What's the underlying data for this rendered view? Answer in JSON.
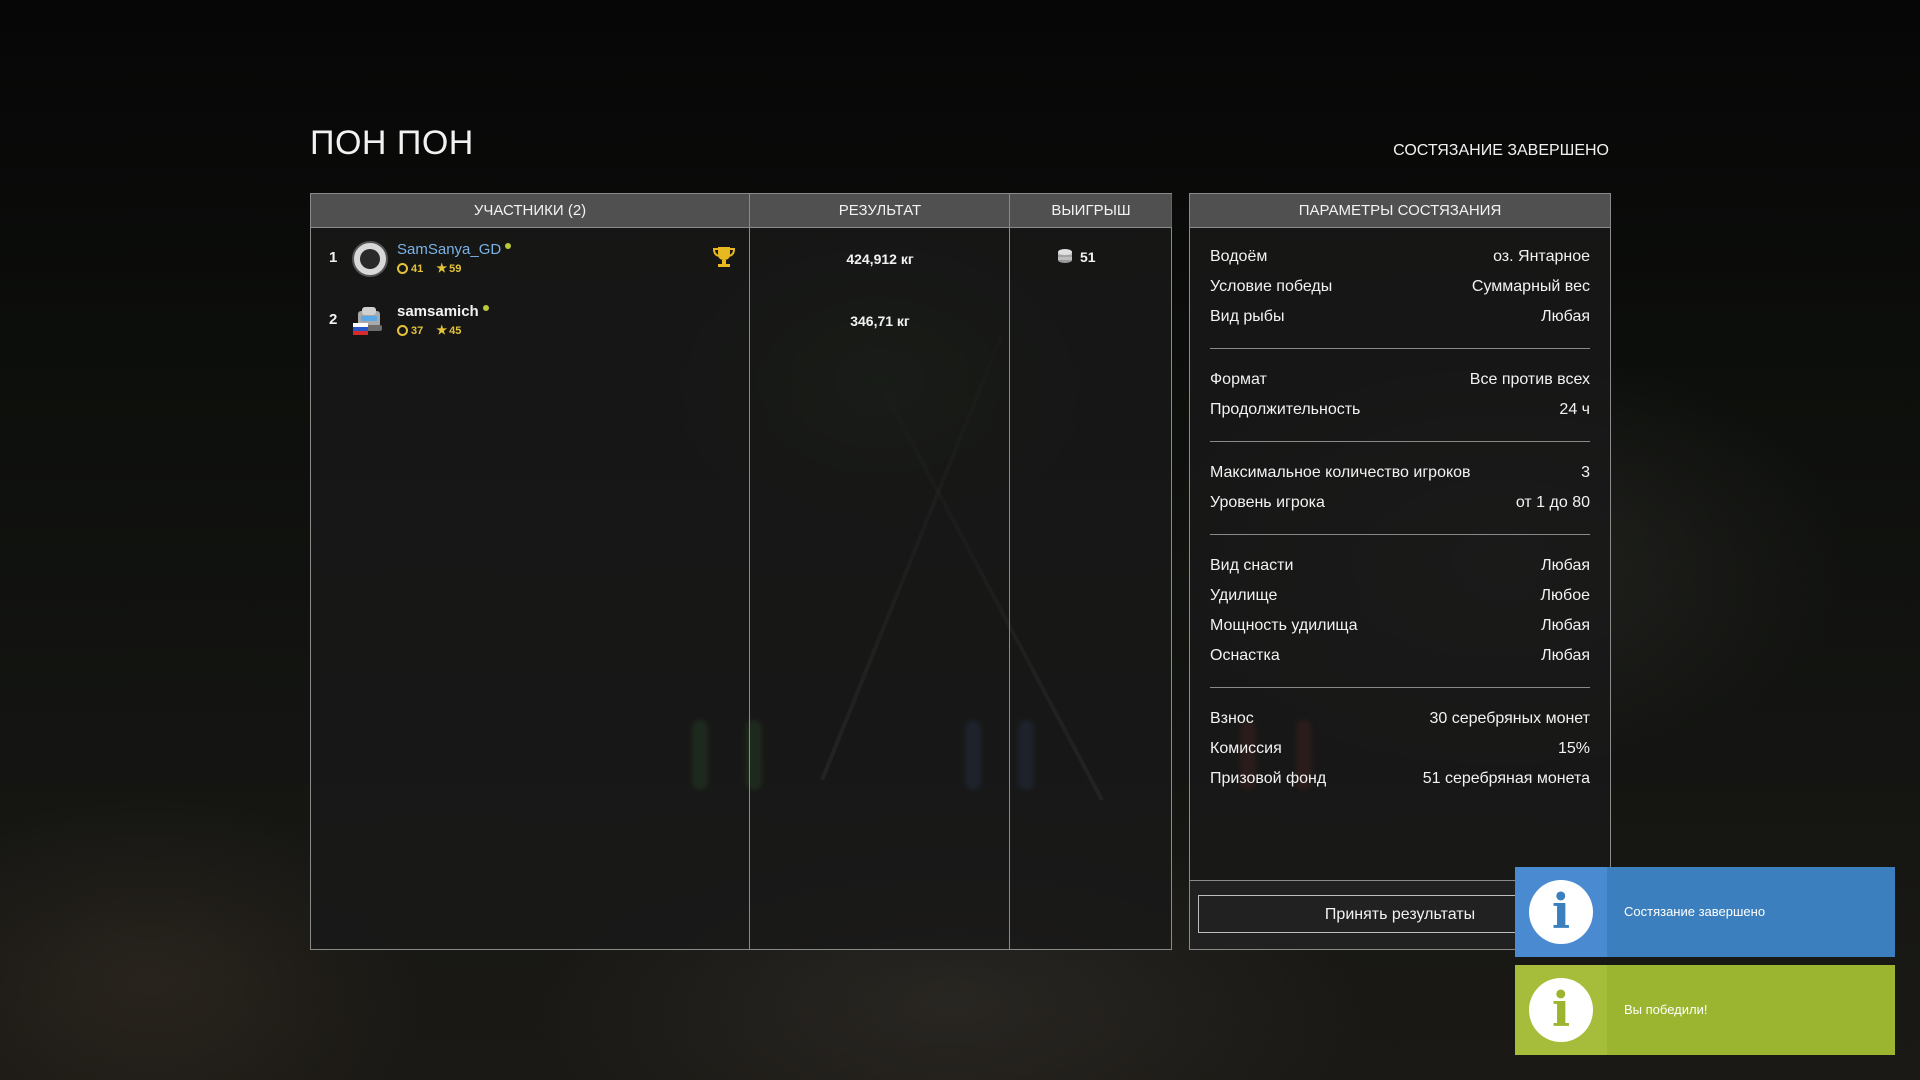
{
  "competition": {
    "title": "ПОН ПОН",
    "status": "СОСТЯЗАНИЕ ЗАВЕРШЕНО"
  },
  "results_table": {
    "headers": {
      "participants": "УЧАСТНИКИ (2)",
      "result": "РЕЗУЛЬТАТ",
      "prize": "ВЫИГРЫШ"
    },
    "rows": [
      {
        "rank": "1",
        "name": "SamSanya_GD",
        "name_color": "#7ab3e6",
        "level": "41",
        "rank_stars": "59",
        "result": "424,912 кг",
        "prize": "51",
        "winner": true
      },
      {
        "rank": "2",
        "name": "samsamich",
        "name_color": "#f2f2f2",
        "level": "37",
        "rank_stars": "45",
        "result": "346,71 кг",
        "prize": "",
        "winner": false
      }
    ]
  },
  "parameters": {
    "header": "ПАРАМЕТРЫ СОСТЯЗАНИЯ",
    "groups": [
      [
        {
          "label": "Водоём",
          "value": "оз. Янтарное"
        },
        {
          "label": "Условие победы",
          "value": "Суммарный вес"
        },
        {
          "label": "Вид рыбы",
          "value": "Любая"
        }
      ],
      [
        {
          "label": "Формат",
          "value": "Все против всех"
        },
        {
          "label": "Продолжительность",
          "value": "24 ч"
        }
      ],
      [
        {
          "label": "Максимальное количество игроков",
          "value": "3"
        },
        {
          "label": "Уровень игрока",
          "value": "от 1 до 80"
        }
      ],
      [
        {
          "label": "Вид снасти",
          "value": "Любая"
        },
        {
          "label": "Удилище",
          "value": "Любое"
        },
        {
          "label": "Мощность удилища",
          "value": "Любая"
        },
        {
          "label": "Оснастка",
          "value": "Любая"
        }
      ],
      [
        {
          "label": "Взнос",
          "value": "30 серебряных монет"
        },
        {
          "label": "Комиссия",
          "value": "15%"
        },
        {
          "label": "Призовой фонд",
          "value": "51 серебряная монета"
        }
      ]
    ],
    "accept_button": "Принять результаты"
  },
  "notifications": [
    {
      "icon": "info-icon",
      "text": "Состязание завершено",
      "color": "#3b7fbe"
    },
    {
      "icon": "info-icon",
      "text": "Вы победили!",
      "color": "#9bb530"
    }
  ],
  "icons": {
    "level": "ring-icon",
    "rank": "star-icon",
    "winner": "trophy-icon",
    "currency": "silver-coin-icon",
    "country": "russia-flag-icon"
  }
}
